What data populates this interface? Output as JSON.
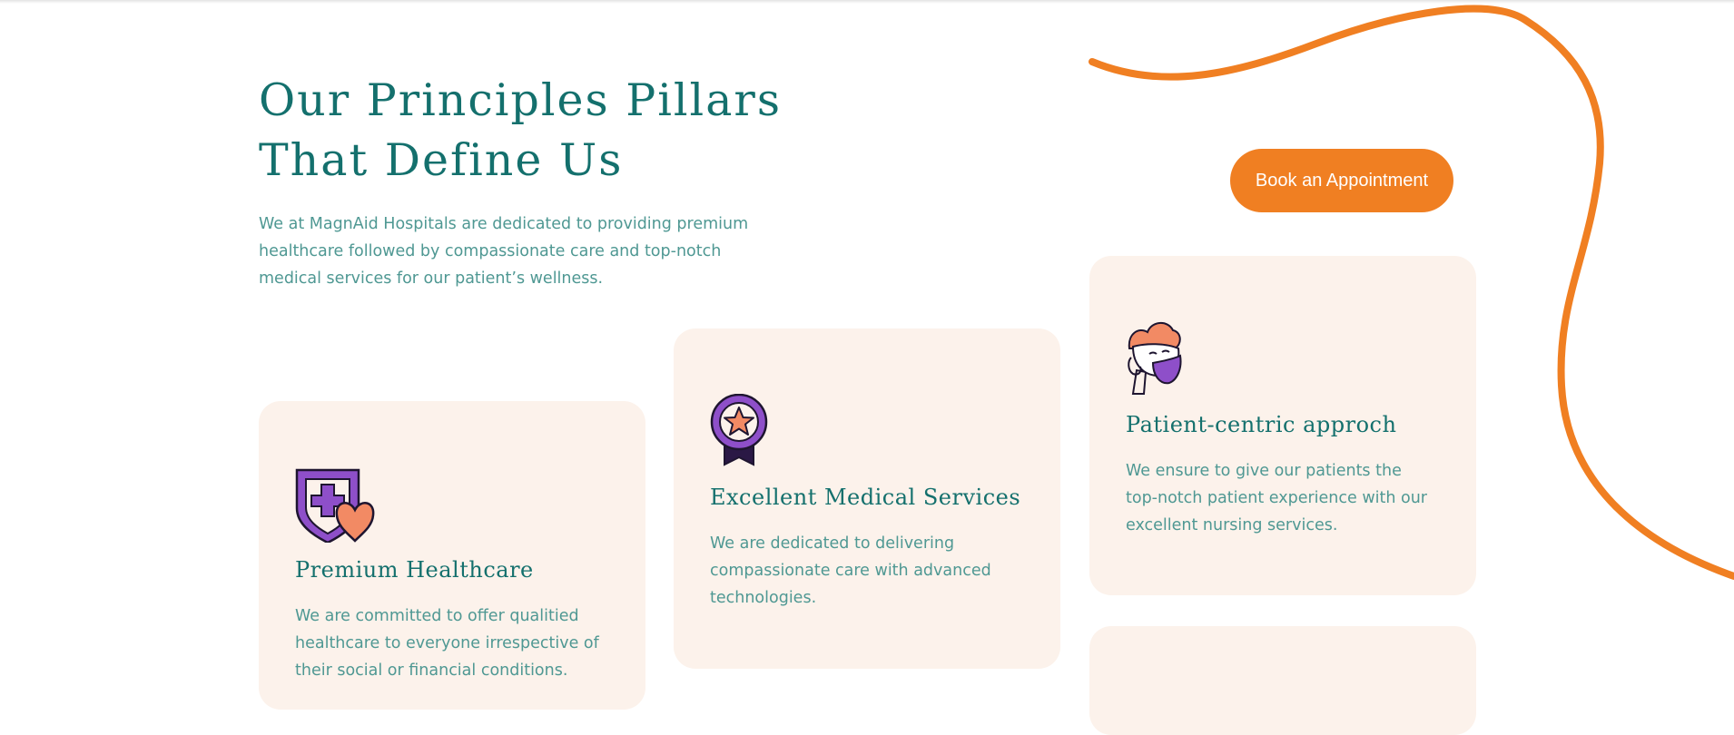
{
  "heading": {
    "line1": "Our Principles Pillars",
    "line2": "That Define Us"
  },
  "intro": "We at MagnAid Hospitals are dedicated to providing premium healthcare followed by compassionate care and top-notch medical services for our patient’s wellness.",
  "cta": {
    "label": "Book an Appointment"
  },
  "colors": {
    "accent": "#f07f22",
    "heading": "#14706d",
    "body_text": "#4f9893",
    "card_bg": "#fcf2eb",
    "purple": "#8e4fc9",
    "coral": "#f28a64"
  },
  "cards": [
    {
      "icon": "shield-heart-icon",
      "title": "Premium Healthcare",
      "text": "We are committed to offer qualitied healthcare to everyone irrespective of their social or financial conditions."
    },
    {
      "icon": "award-badge-icon",
      "title": "Excellent Medical Services",
      "text": "We are dedicated to delivering compassionate care with advanced technologies."
    },
    {
      "icon": "nurse-character-icon",
      "title": "Patient-centric approch",
      "text": "We ensure to give our patients the top-notch patient experience with our excellent nursing services."
    }
  ]
}
